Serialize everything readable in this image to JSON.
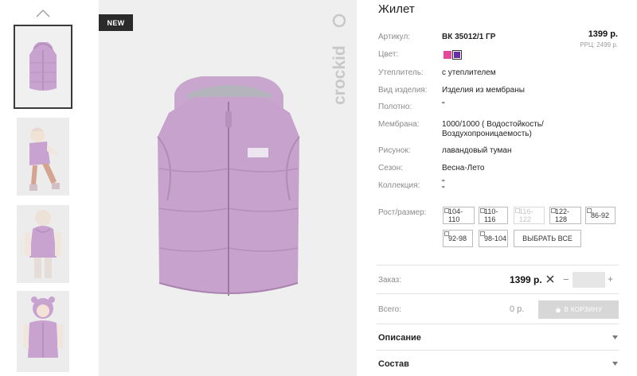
{
  "product": {
    "title": "Жилет",
    "badge": "NEW",
    "brand": "crockid",
    "price": "1399 р.",
    "rrc": "РРЦ: 2499 р.",
    "colors": [
      "#e8459c",
      "#6b2fa5"
    ],
    "selected_color": "#6b2fa5"
  },
  "specs": [
    {
      "label": "Артикул:",
      "value": "ВК 35012/1 ГР"
    },
    {
      "label": "Цвет:",
      "value": ""
    },
    {
      "label": "Утеплитель:",
      "value": "с утеплителем"
    },
    {
      "label": "Вид изделия:",
      "value": "Изделия из мембраны"
    },
    {
      "label": "Полотно:",
      "value": "\""
    },
    {
      "label": "Мембрана:",
      "value": "1000/1000 ( Водостойкость/",
      "value2": "Воздухопроницаемость)"
    },
    {
      "label": "Рисунок:",
      "value": "лавандовый туман"
    },
    {
      "label": "Сезон:",
      "value": "Весна-Лето"
    },
    {
      "label": "Коллекция:",
      "value": "\"",
      "value2": "\""
    }
  ],
  "sizes": {
    "label": "Рост/размер:",
    "items": [
      {
        "label": "104-110",
        "available": true
      },
      {
        "label": "110-116",
        "available": true
      },
      {
        "label": "116-122",
        "available": false
      },
      {
        "label": "122-128",
        "available": true
      },
      {
        "label": "86-92",
        "available": true
      },
      {
        "label": "92-98",
        "available": true
      },
      {
        "label": "98-104",
        "available": true
      }
    ],
    "select_all": "ВЫБРАТЬ ВСЕ"
  },
  "order": {
    "label": "Заказ:",
    "price": "1399 р.",
    "minus": "−",
    "plus": "+",
    "qty": ""
  },
  "total": {
    "label": "Всего:",
    "value": "0 р.",
    "cart_button": "В КОРЗИНУ"
  },
  "accordion": [
    {
      "label": "Описание"
    },
    {
      "label": "Состав"
    }
  ],
  "icons": {
    "thumbs_up": "chevron-up-icon",
    "remove": "close-icon",
    "cart": "basket-icon",
    "expand": "caret-down-icon"
  }
}
